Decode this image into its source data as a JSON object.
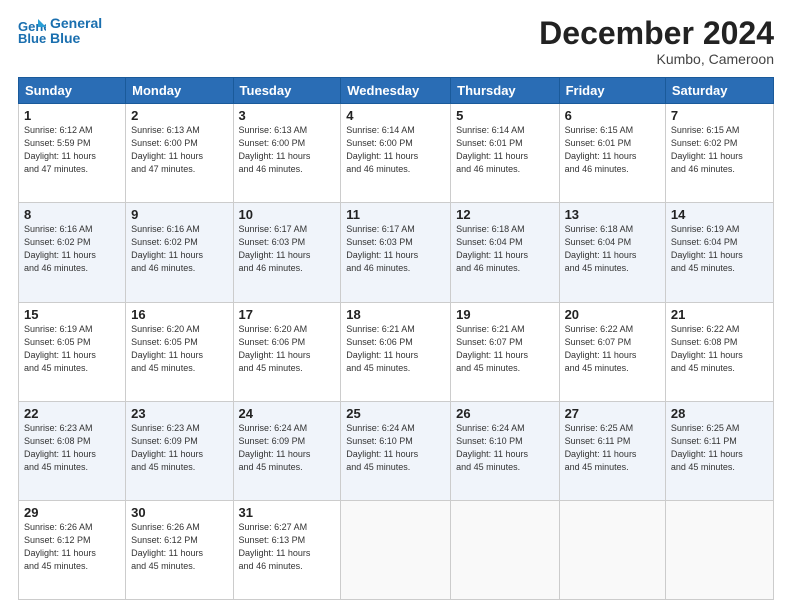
{
  "logo": {
    "line1": "General",
    "line2": "Blue"
  },
  "header": {
    "month": "December 2024",
    "location": "Kumbo, Cameroon"
  },
  "weekdays": [
    "Sunday",
    "Monday",
    "Tuesday",
    "Wednesday",
    "Thursday",
    "Friday",
    "Saturday"
  ],
  "weeks": [
    [
      {
        "day": "1",
        "detail": "Sunrise: 6:12 AM\nSunset: 5:59 PM\nDaylight: 11 hours\nand 47 minutes."
      },
      {
        "day": "2",
        "detail": "Sunrise: 6:13 AM\nSunset: 6:00 PM\nDaylight: 11 hours\nand 47 minutes."
      },
      {
        "day": "3",
        "detail": "Sunrise: 6:13 AM\nSunset: 6:00 PM\nDaylight: 11 hours\nand 46 minutes."
      },
      {
        "day": "4",
        "detail": "Sunrise: 6:14 AM\nSunset: 6:00 PM\nDaylight: 11 hours\nand 46 minutes."
      },
      {
        "day": "5",
        "detail": "Sunrise: 6:14 AM\nSunset: 6:01 PM\nDaylight: 11 hours\nand 46 minutes."
      },
      {
        "day": "6",
        "detail": "Sunrise: 6:15 AM\nSunset: 6:01 PM\nDaylight: 11 hours\nand 46 minutes."
      },
      {
        "day": "7",
        "detail": "Sunrise: 6:15 AM\nSunset: 6:02 PM\nDaylight: 11 hours\nand 46 minutes."
      }
    ],
    [
      {
        "day": "8",
        "detail": "Sunrise: 6:16 AM\nSunset: 6:02 PM\nDaylight: 11 hours\nand 46 minutes."
      },
      {
        "day": "9",
        "detail": "Sunrise: 6:16 AM\nSunset: 6:02 PM\nDaylight: 11 hours\nand 46 minutes."
      },
      {
        "day": "10",
        "detail": "Sunrise: 6:17 AM\nSunset: 6:03 PM\nDaylight: 11 hours\nand 46 minutes."
      },
      {
        "day": "11",
        "detail": "Sunrise: 6:17 AM\nSunset: 6:03 PM\nDaylight: 11 hours\nand 46 minutes."
      },
      {
        "day": "12",
        "detail": "Sunrise: 6:18 AM\nSunset: 6:04 PM\nDaylight: 11 hours\nand 46 minutes."
      },
      {
        "day": "13",
        "detail": "Sunrise: 6:18 AM\nSunset: 6:04 PM\nDaylight: 11 hours\nand 45 minutes."
      },
      {
        "day": "14",
        "detail": "Sunrise: 6:19 AM\nSunset: 6:04 PM\nDaylight: 11 hours\nand 45 minutes."
      }
    ],
    [
      {
        "day": "15",
        "detail": "Sunrise: 6:19 AM\nSunset: 6:05 PM\nDaylight: 11 hours\nand 45 minutes."
      },
      {
        "day": "16",
        "detail": "Sunrise: 6:20 AM\nSunset: 6:05 PM\nDaylight: 11 hours\nand 45 minutes."
      },
      {
        "day": "17",
        "detail": "Sunrise: 6:20 AM\nSunset: 6:06 PM\nDaylight: 11 hours\nand 45 minutes."
      },
      {
        "day": "18",
        "detail": "Sunrise: 6:21 AM\nSunset: 6:06 PM\nDaylight: 11 hours\nand 45 minutes."
      },
      {
        "day": "19",
        "detail": "Sunrise: 6:21 AM\nSunset: 6:07 PM\nDaylight: 11 hours\nand 45 minutes."
      },
      {
        "day": "20",
        "detail": "Sunrise: 6:22 AM\nSunset: 6:07 PM\nDaylight: 11 hours\nand 45 minutes."
      },
      {
        "day": "21",
        "detail": "Sunrise: 6:22 AM\nSunset: 6:08 PM\nDaylight: 11 hours\nand 45 minutes."
      }
    ],
    [
      {
        "day": "22",
        "detail": "Sunrise: 6:23 AM\nSunset: 6:08 PM\nDaylight: 11 hours\nand 45 minutes."
      },
      {
        "day": "23",
        "detail": "Sunrise: 6:23 AM\nSunset: 6:09 PM\nDaylight: 11 hours\nand 45 minutes."
      },
      {
        "day": "24",
        "detail": "Sunrise: 6:24 AM\nSunset: 6:09 PM\nDaylight: 11 hours\nand 45 minutes."
      },
      {
        "day": "25",
        "detail": "Sunrise: 6:24 AM\nSunset: 6:10 PM\nDaylight: 11 hours\nand 45 minutes."
      },
      {
        "day": "26",
        "detail": "Sunrise: 6:24 AM\nSunset: 6:10 PM\nDaylight: 11 hours\nand 45 minutes."
      },
      {
        "day": "27",
        "detail": "Sunrise: 6:25 AM\nSunset: 6:11 PM\nDaylight: 11 hours\nand 45 minutes."
      },
      {
        "day": "28",
        "detail": "Sunrise: 6:25 AM\nSunset: 6:11 PM\nDaylight: 11 hours\nand 45 minutes."
      }
    ],
    [
      {
        "day": "29",
        "detail": "Sunrise: 6:26 AM\nSunset: 6:12 PM\nDaylight: 11 hours\nand 45 minutes."
      },
      {
        "day": "30",
        "detail": "Sunrise: 6:26 AM\nSunset: 6:12 PM\nDaylight: 11 hours\nand 45 minutes."
      },
      {
        "day": "31",
        "detail": "Sunrise: 6:27 AM\nSunset: 6:13 PM\nDaylight: 11 hours\nand 46 minutes."
      },
      {
        "day": "",
        "detail": ""
      },
      {
        "day": "",
        "detail": ""
      },
      {
        "day": "",
        "detail": ""
      },
      {
        "day": "",
        "detail": ""
      }
    ]
  ]
}
